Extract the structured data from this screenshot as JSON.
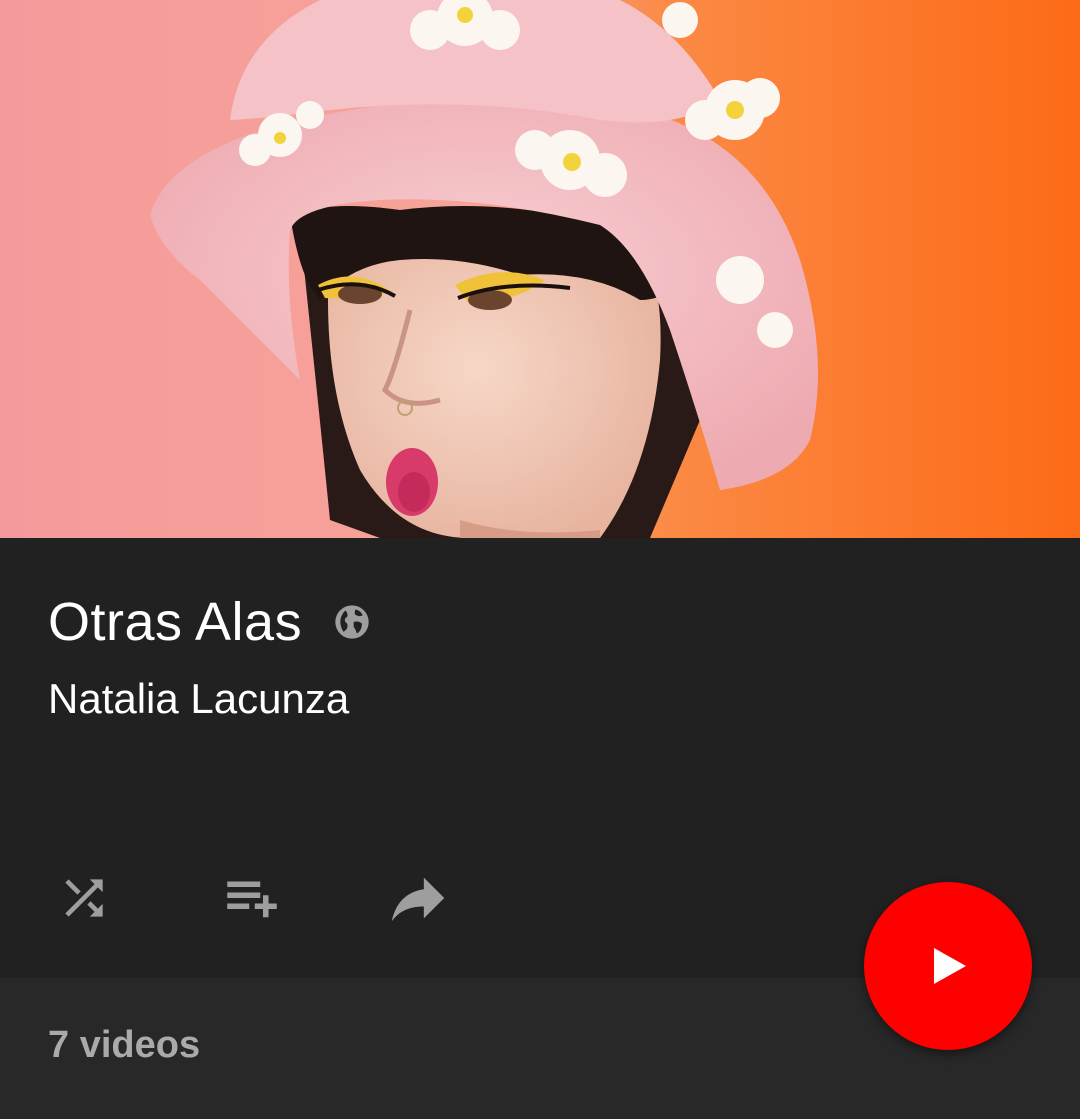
{
  "cover": {
    "icon": "playlist-cover-image"
  },
  "playlist": {
    "title": "Otras Alas",
    "visibility_icon": "globe-icon",
    "author": "Natalia Lacunza",
    "video_count": "7 videos"
  },
  "actions": [
    {
      "icon": "shuffle-icon"
    },
    {
      "icon": "add-to-queue-icon"
    },
    {
      "icon": "share-icon"
    }
  ],
  "fab": {
    "icon": "play-icon",
    "color": "#ff0000"
  },
  "colors": {
    "background": "#212121",
    "footer": "#282828",
    "icon_gray": "#9e9e9e",
    "count_text": "#aaaaaa"
  }
}
